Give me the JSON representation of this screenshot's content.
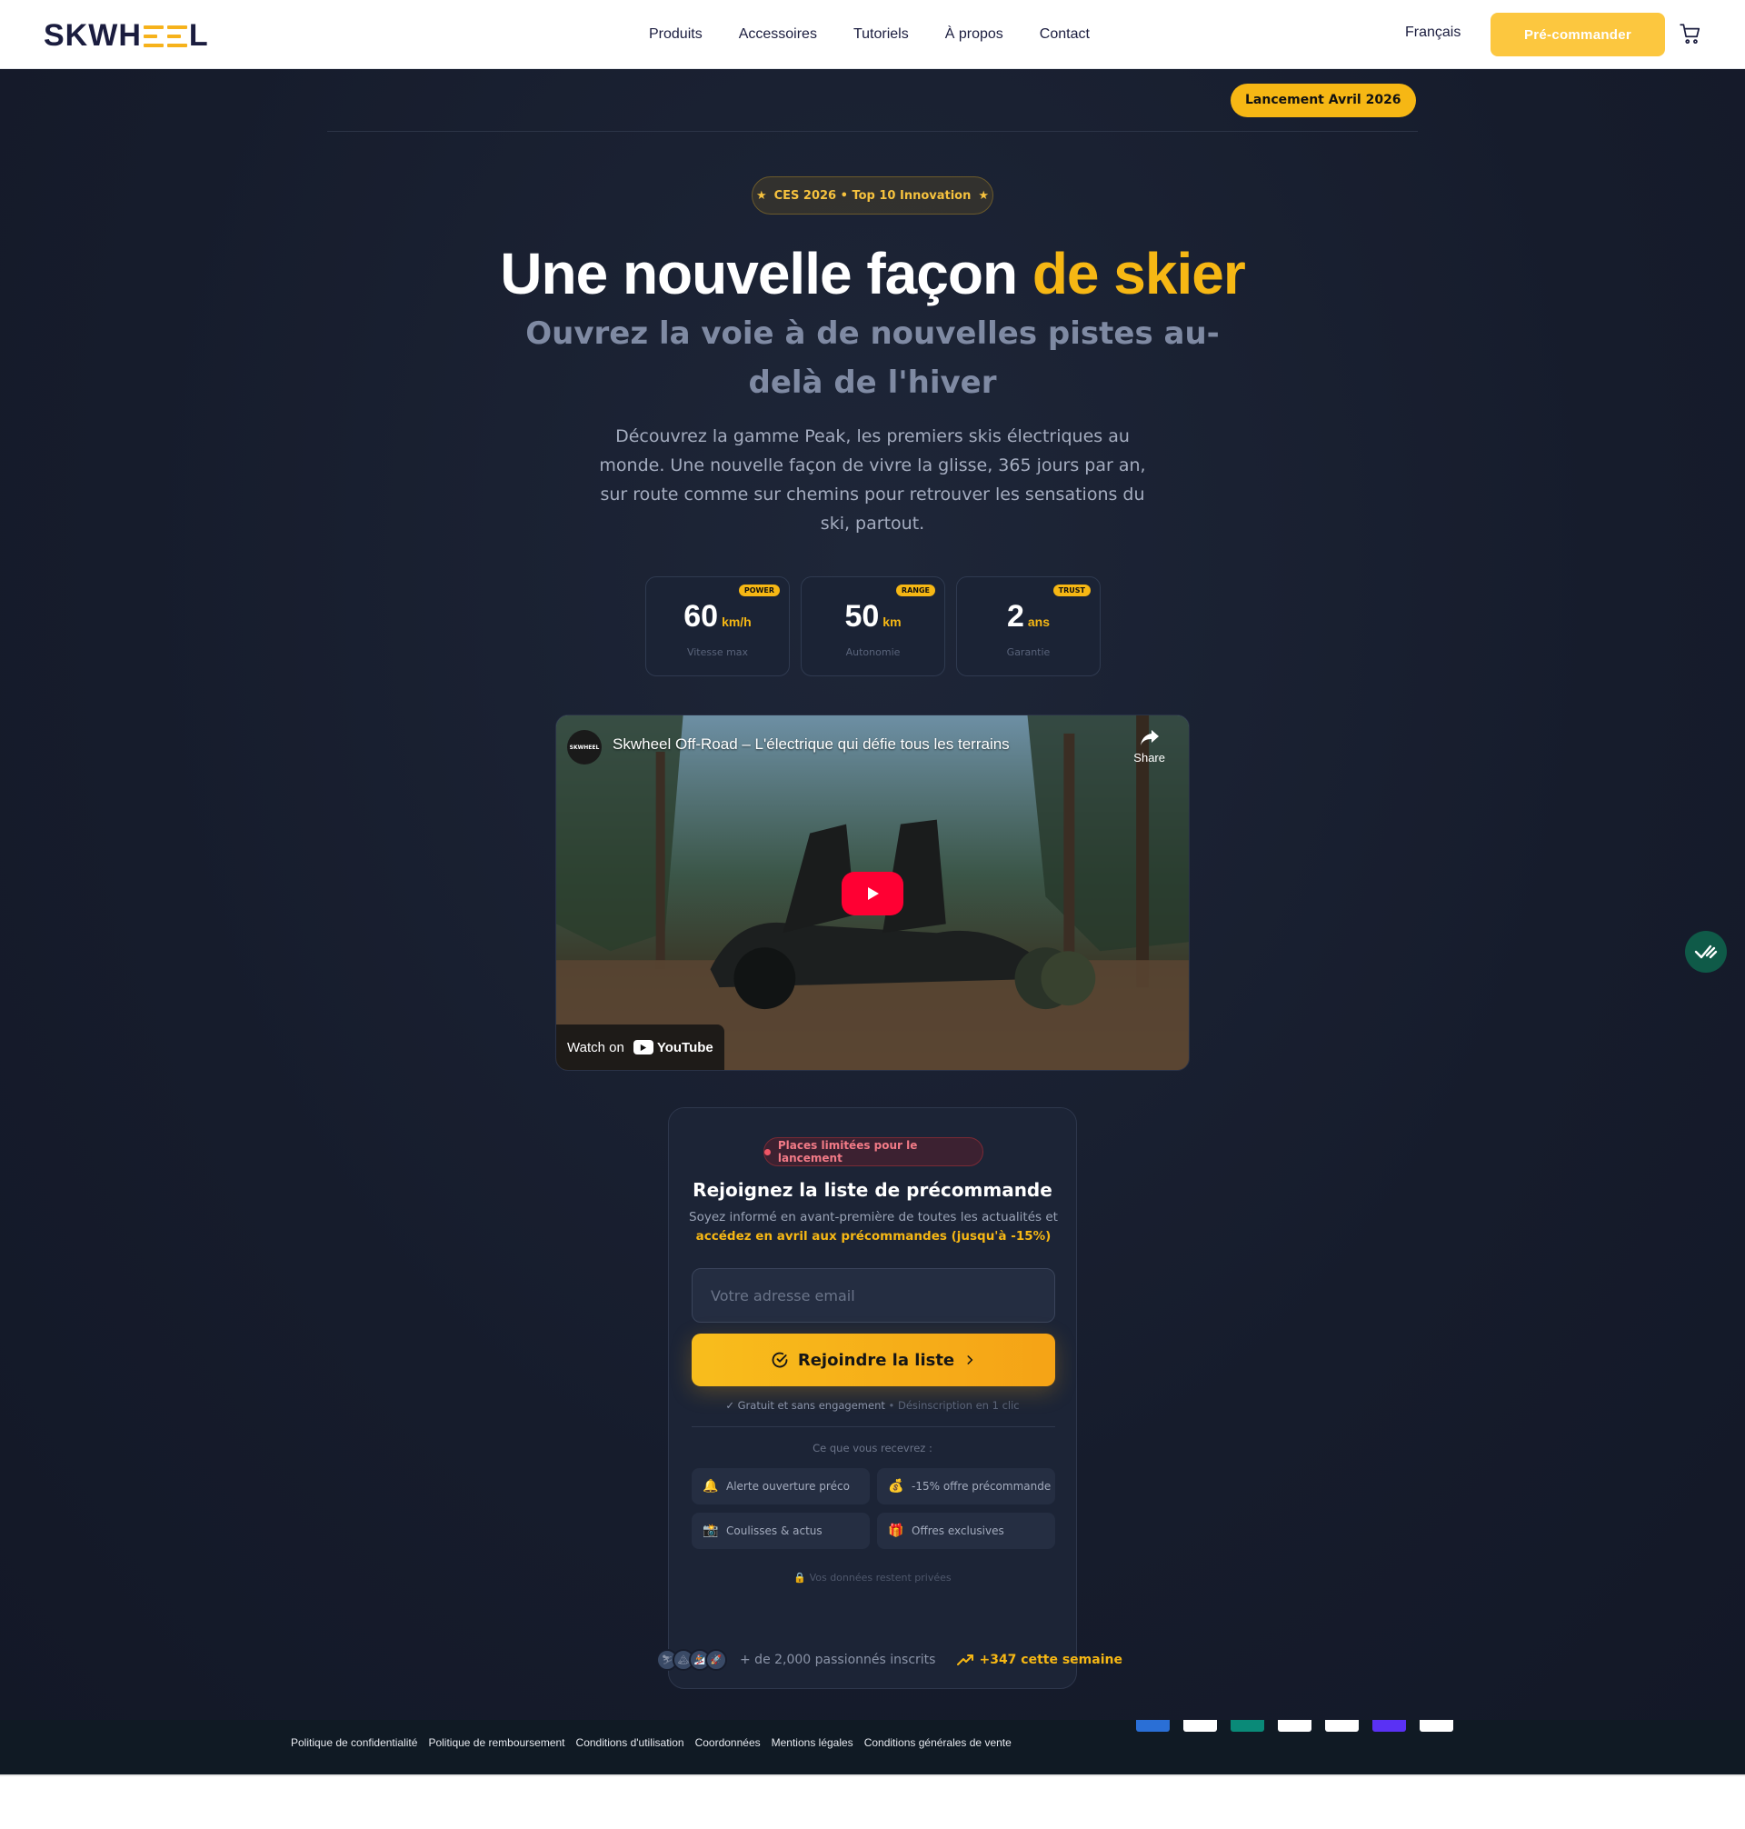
{
  "header": {
    "brand": "SKWHEEL",
    "brand_parts": [
      "SKWH",
      "L"
    ],
    "nav": [
      "Produits",
      "Accessoires",
      "Tutoriels",
      "À propos",
      "Contact"
    ],
    "language": "Français",
    "preorder_label": "Pré-commander",
    "cart_icon": "cart-icon"
  },
  "hero": {
    "launch_badge": "Lancement Avril 2026",
    "ces_pill": "CES 2026 • Top 10 Innovation",
    "title_main": "Une nouvelle façon ",
    "title_accent": "de skier",
    "subtitle": "Ouvrez la voie à de nouvelles pistes au-delà de l'hiver",
    "lead": "Découvrez la gamme Peak, les premiers skis électriques au monde. Une nouvelle façon de vivre la glisse, 365 jours par an, sur route comme sur chemins pour retrouver les sensations du ski, partout."
  },
  "stats": [
    {
      "tag": "POWER",
      "value": "60",
      "unit": "km/h",
      "label": "Vitesse max"
    },
    {
      "tag": "RANGE",
      "value": "50",
      "unit": "km",
      "label": "Autonomie"
    },
    {
      "tag": "TRUST",
      "value": "2",
      "unit": "ans",
      "label": "Garantie"
    }
  ],
  "video": {
    "channel": "SKWHEEL",
    "title": "Skwheel Off-Road – L'électrique qui défie tous les terrains",
    "share_label": "Share",
    "watch_on": "Watch on",
    "youtube": "YouTube"
  },
  "signup": {
    "limited": "Places limitées pour le lancement",
    "title": "Rejoignez la liste de précommande",
    "subtitle_plain": "Soyez informé en avant-première de toutes les actualités et ",
    "subtitle_highlight": "accédez en avril aux précommandes (jusqu'à -15%)",
    "email_placeholder": "Votre adresse email",
    "join_label": "Rejoindre la liste",
    "free_text": "✓ Gratuit et sans engagement",
    "free_dim": " • Désinscription en 1 clic",
    "receive_label": "Ce que vous recevrez :",
    "perks": [
      {
        "icon": "🔔",
        "label": "Alerte ouverture préco"
      },
      {
        "icon": "💰",
        "label": "-15% offre précommande"
      },
      {
        "icon": "📸",
        "label": "Coulisses & actus"
      },
      {
        "icon": "🎁",
        "label": "Offres exclusives"
      }
    ],
    "privacy_icon": "🔒",
    "privacy": " Vos données restent privées"
  },
  "social": {
    "avatars": [
      "⛷",
      "🏔",
      "🏂",
      "🚀"
    ],
    "count_text": "+ de 2,000 passionnés inscrits",
    "trend_text": "+347 cette semaine"
  },
  "footer": {
    "links": [
      "Politique de confidentialité",
      "Politique de remboursement",
      "Conditions d'utilisation",
      "Coordonnées",
      "Mentions légales",
      "Conditions générales de vente"
    ],
    "payments": [
      {
        "name": "amex",
        "color": "#2a6fd6"
      },
      {
        "name": "apple-pay",
        "color": "#ffffff"
      },
      {
        "name": "bancontact",
        "color": "#0a8a78"
      },
      {
        "name": "mastercard",
        "color": "#ffffff"
      },
      {
        "name": "paypal",
        "color": "#ffffff"
      },
      {
        "name": "shop-pay",
        "color": "#5a31f4"
      },
      {
        "name": "visa",
        "color": "#ffffff"
      }
    ]
  },
  "colors": {
    "accent": "#f6b714",
    "bg_dark": "#161c2c",
    "card": "#1c2436",
    "brand_navy": "#1b1d3f"
  }
}
